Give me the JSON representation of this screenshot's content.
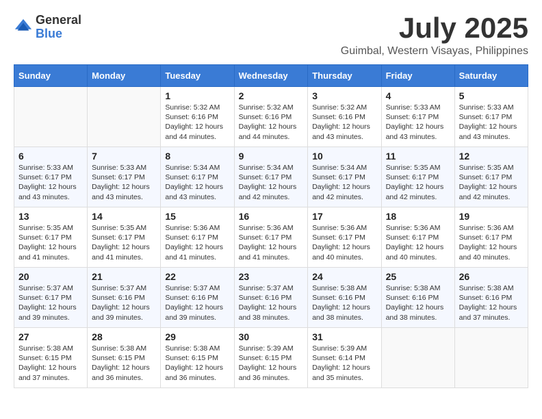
{
  "header": {
    "logo_general": "General",
    "logo_blue": "Blue",
    "month_title": "July 2025",
    "location": "Guimbal, Western Visayas, Philippines"
  },
  "days_of_week": [
    "Sunday",
    "Monday",
    "Tuesday",
    "Wednesday",
    "Thursday",
    "Friday",
    "Saturday"
  ],
  "weeks": [
    [
      {
        "day": "",
        "sunrise": "",
        "sunset": "",
        "daylight": ""
      },
      {
        "day": "",
        "sunrise": "",
        "sunset": "",
        "daylight": ""
      },
      {
        "day": "1",
        "sunrise": "Sunrise: 5:32 AM",
        "sunset": "Sunset: 6:16 PM",
        "daylight": "Daylight: 12 hours and 44 minutes."
      },
      {
        "day": "2",
        "sunrise": "Sunrise: 5:32 AM",
        "sunset": "Sunset: 6:16 PM",
        "daylight": "Daylight: 12 hours and 44 minutes."
      },
      {
        "day": "3",
        "sunrise": "Sunrise: 5:32 AM",
        "sunset": "Sunset: 6:16 PM",
        "daylight": "Daylight: 12 hours and 43 minutes."
      },
      {
        "day": "4",
        "sunrise": "Sunrise: 5:33 AM",
        "sunset": "Sunset: 6:17 PM",
        "daylight": "Daylight: 12 hours and 43 minutes."
      },
      {
        "day": "5",
        "sunrise": "Sunrise: 5:33 AM",
        "sunset": "Sunset: 6:17 PM",
        "daylight": "Daylight: 12 hours and 43 minutes."
      }
    ],
    [
      {
        "day": "6",
        "sunrise": "Sunrise: 5:33 AM",
        "sunset": "Sunset: 6:17 PM",
        "daylight": "Daylight: 12 hours and 43 minutes."
      },
      {
        "day": "7",
        "sunrise": "Sunrise: 5:33 AM",
        "sunset": "Sunset: 6:17 PM",
        "daylight": "Daylight: 12 hours and 43 minutes."
      },
      {
        "day": "8",
        "sunrise": "Sunrise: 5:34 AM",
        "sunset": "Sunset: 6:17 PM",
        "daylight": "Daylight: 12 hours and 43 minutes."
      },
      {
        "day": "9",
        "sunrise": "Sunrise: 5:34 AM",
        "sunset": "Sunset: 6:17 PM",
        "daylight": "Daylight: 12 hours and 42 minutes."
      },
      {
        "day": "10",
        "sunrise": "Sunrise: 5:34 AM",
        "sunset": "Sunset: 6:17 PM",
        "daylight": "Daylight: 12 hours and 42 minutes."
      },
      {
        "day": "11",
        "sunrise": "Sunrise: 5:35 AM",
        "sunset": "Sunset: 6:17 PM",
        "daylight": "Daylight: 12 hours and 42 minutes."
      },
      {
        "day": "12",
        "sunrise": "Sunrise: 5:35 AM",
        "sunset": "Sunset: 6:17 PM",
        "daylight": "Daylight: 12 hours and 42 minutes."
      }
    ],
    [
      {
        "day": "13",
        "sunrise": "Sunrise: 5:35 AM",
        "sunset": "Sunset: 6:17 PM",
        "daylight": "Daylight: 12 hours and 41 minutes."
      },
      {
        "day": "14",
        "sunrise": "Sunrise: 5:35 AM",
        "sunset": "Sunset: 6:17 PM",
        "daylight": "Daylight: 12 hours and 41 minutes."
      },
      {
        "day": "15",
        "sunrise": "Sunrise: 5:36 AM",
        "sunset": "Sunset: 6:17 PM",
        "daylight": "Daylight: 12 hours and 41 minutes."
      },
      {
        "day": "16",
        "sunrise": "Sunrise: 5:36 AM",
        "sunset": "Sunset: 6:17 PM",
        "daylight": "Daylight: 12 hours and 41 minutes."
      },
      {
        "day": "17",
        "sunrise": "Sunrise: 5:36 AM",
        "sunset": "Sunset: 6:17 PM",
        "daylight": "Daylight: 12 hours and 40 minutes."
      },
      {
        "day": "18",
        "sunrise": "Sunrise: 5:36 AM",
        "sunset": "Sunset: 6:17 PM",
        "daylight": "Daylight: 12 hours and 40 minutes."
      },
      {
        "day": "19",
        "sunrise": "Sunrise: 5:36 AM",
        "sunset": "Sunset: 6:17 PM",
        "daylight": "Daylight: 12 hours and 40 minutes."
      }
    ],
    [
      {
        "day": "20",
        "sunrise": "Sunrise: 5:37 AM",
        "sunset": "Sunset: 6:17 PM",
        "daylight": "Daylight: 12 hours and 39 minutes."
      },
      {
        "day": "21",
        "sunrise": "Sunrise: 5:37 AM",
        "sunset": "Sunset: 6:16 PM",
        "daylight": "Daylight: 12 hours and 39 minutes."
      },
      {
        "day": "22",
        "sunrise": "Sunrise: 5:37 AM",
        "sunset": "Sunset: 6:16 PM",
        "daylight": "Daylight: 12 hours and 39 minutes."
      },
      {
        "day": "23",
        "sunrise": "Sunrise: 5:37 AM",
        "sunset": "Sunset: 6:16 PM",
        "daylight": "Daylight: 12 hours and 38 minutes."
      },
      {
        "day": "24",
        "sunrise": "Sunrise: 5:38 AM",
        "sunset": "Sunset: 6:16 PM",
        "daylight": "Daylight: 12 hours and 38 minutes."
      },
      {
        "day": "25",
        "sunrise": "Sunrise: 5:38 AM",
        "sunset": "Sunset: 6:16 PM",
        "daylight": "Daylight: 12 hours and 38 minutes."
      },
      {
        "day": "26",
        "sunrise": "Sunrise: 5:38 AM",
        "sunset": "Sunset: 6:16 PM",
        "daylight": "Daylight: 12 hours and 37 minutes."
      }
    ],
    [
      {
        "day": "27",
        "sunrise": "Sunrise: 5:38 AM",
        "sunset": "Sunset: 6:15 PM",
        "daylight": "Daylight: 12 hours and 37 minutes."
      },
      {
        "day": "28",
        "sunrise": "Sunrise: 5:38 AM",
        "sunset": "Sunset: 6:15 PM",
        "daylight": "Daylight: 12 hours and 36 minutes."
      },
      {
        "day": "29",
        "sunrise": "Sunrise: 5:38 AM",
        "sunset": "Sunset: 6:15 PM",
        "daylight": "Daylight: 12 hours and 36 minutes."
      },
      {
        "day": "30",
        "sunrise": "Sunrise: 5:39 AM",
        "sunset": "Sunset: 6:15 PM",
        "daylight": "Daylight: 12 hours and 36 minutes."
      },
      {
        "day": "31",
        "sunrise": "Sunrise: 5:39 AM",
        "sunset": "Sunset: 6:14 PM",
        "daylight": "Daylight: 12 hours and 35 minutes."
      },
      {
        "day": "",
        "sunrise": "",
        "sunset": "",
        "daylight": ""
      },
      {
        "day": "",
        "sunrise": "",
        "sunset": "",
        "daylight": ""
      }
    ]
  ]
}
